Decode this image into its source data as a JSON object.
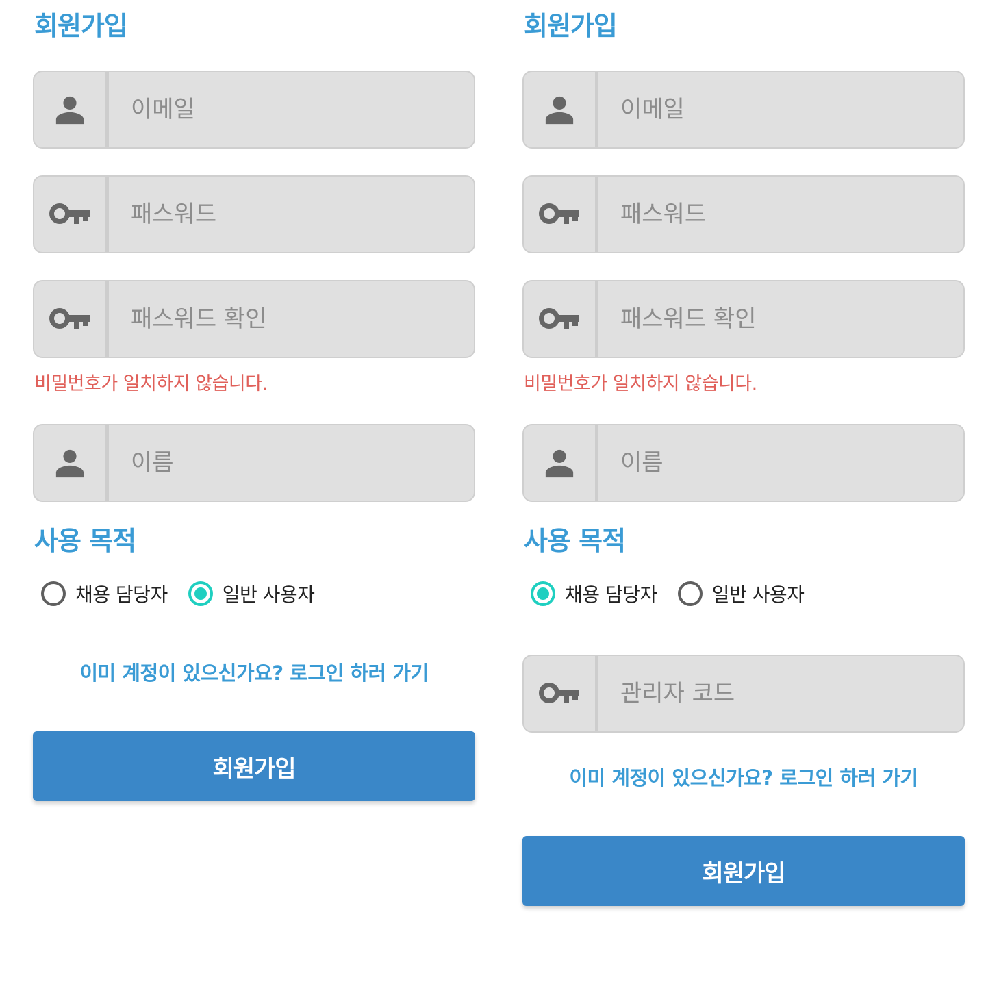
{
  "left_form": {
    "title": "회원가입",
    "email_placeholder": "이메일",
    "password_placeholder": "패스워드",
    "password_confirm_placeholder": "패스워드 확인",
    "error_message": "비밀번호가 일치하지 않습니다.",
    "name_placeholder": "이름",
    "purpose_title": "사용 목적",
    "purpose_options": [
      {
        "label": "채용 담당자",
        "selected": false
      },
      {
        "label": "일반 사용자",
        "selected": true
      }
    ],
    "login_link": "이미 계정이 있으신가요? 로그인 하러 가기",
    "submit_label": "회원가입"
  },
  "right_form": {
    "title": "회원가입",
    "email_placeholder": "이메일",
    "password_placeholder": "패스워드",
    "password_confirm_placeholder": "패스워드 확인",
    "error_message": "비밀번호가 일치하지 않습니다.",
    "name_placeholder": "이름",
    "purpose_title": "사용 목적",
    "purpose_options": [
      {
        "label": "채용 담당자",
        "selected": true
      },
      {
        "label": "일반 사용자",
        "selected": false
      }
    ],
    "admin_code_placeholder": "관리자 코드",
    "login_link": "이미 계정이 있으신가요? 로그인 하러 가기",
    "submit_label": "회원가입"
  },
  "colors": {
    "accent": "#3a9bd5",
    "button": "#3a87c8",
    "error": "#e0605a",
    "radio_checked": "#1fcfc0",
    "field_bg": "#e0e0e0"
  },
  "icons": {
    "person": "person-icon",
    "key": "key-icon"
  }
}
